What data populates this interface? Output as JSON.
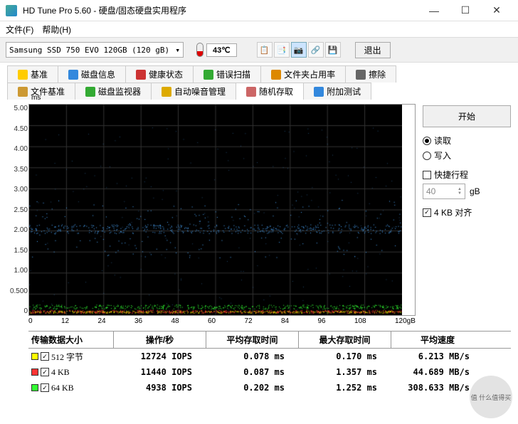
{
  "window": {
    "title": "HD Tune Pro 5.60 - 硬盘/固态硬盘实用程序",
    "minimize": "—",
    "maximize": "☐",
    "close": "✕"
  },
  "menu": {
    "file": "文件(F)",
    "help": "帮助(H)"
  },
  "toolbar": {
    "drive": "Samsung SSD 750 EVO 120GB (120 gB)",
    "temp": "43℃",
    "exit": "退出"
  },
  "tabs_row1": [
    {
      "label": "基准",
      "color": "#ffcc00"
    },
    {
      "label": "磁盘信息",
      "color": "#3388dd"
    },
    {
      "label": "健康状态",
      "color": "#cc3333"
    },
    {
      "label": "错误扫描",
      "color": "#33aa33"
    },
    {
      "label": "文件夹占用率",
      "color": "#dd8800"
    },
    {
      "label": "擦除",
      "color": "#666"
    }
  ],
  "tabs_row2": [
    {
      "label": "文件基准",
      "color": "#cc9933"
    },
    {
      "label": "磁盘监视器",
      "color": "#33aa33"
    },
    {
      "label": "自动噪音管理",
      "color": "#ddaa00"
    },
    {
      "label": "随机存取",
      "color": "#cc6666",
      "active": true
    },
    {
      "label": "附加测试",
      "color": "#3388dd"
    }
  ],
  "side": {
    "start": "开始",
    "read": "读取",
    "write": "写入",
    "express": "快捷行程",
    "express_val": "40",
    "express_unit": "gB",
    "align": "4 KB 对齐"
  },
  "chart_data": {
    "type": "scatter",
    "xlabel": "",
    "ylabel": "ms",
    "xlim": [
      0,
      120
    ],
    "ylim": [
      0,
      5.0
    ],
    "x_ticks": [
      "0",
      "12",
      "24",
      "36",
      "48",
      "60",
      "72",
      "84",
      "96",
      "108",
      "120gB"
    ],
    "y_ticks": [
      "5.00",
      "4.50",
      "4.00",
      "3.50",
      "3.00",
      "2.50",
      "2.00",
      "1.50",
      "1.00",
      "0.500",
      "0"
    ],
    "series": [
      {
        "name": "512 字节",
        "color": "#ffff00",
        "band_center": 0.08,
        "band_spread": 0.05
      },
      {
        "name": "4 KB",
        "color": "#ff3333",
        "band_center": 0.09,
        "band_spread": 0.07
      },
      {
        "name": "64 KB",
        "color": "#33ff33",
        "band_center": 0.2,
        "band_spread": 0.1
      }
    ],
    "blue_cluster": {
      "color": "#4aa8ff",
      "center": 2.05,
      "spread": 0.7,
      "density": 600
    }
  },
  "table": {
    "headers": {
      "size": "传输数据大小",
      "ops": "操作/秒",
      "avg": "平均存取时间",
      "max": "最大存取时间",
      "speed": "平均速度"
    },
    "rows": [
      {
        "swatch": "#ffff00",
        "size": "512 字节",
        "ops": "12724 IOPS",
        "avg": "0.078 ms",
        "max": "0.170 ms",
        "speed": "6.213 MB/s"
      },
      {
        "swatch": "#ff3333",
        "size": "4 KB",
        "ops": "11440 IOPS",
        "avg": "0.087 ms",
        "max": "1.357 ms",
        "speed": "44.689 MB/s"
      },
      {
        "swatch": "#33ff33",
        "size": "64 KB",
        "ops": "4938 IOPS",
        "avg": "0.202 ms",
        "max": "1.252 ms",
        "speed": "308.633 MB/s"
      }
    ]
  },
  "watermark": "值 什么值得买"
}
